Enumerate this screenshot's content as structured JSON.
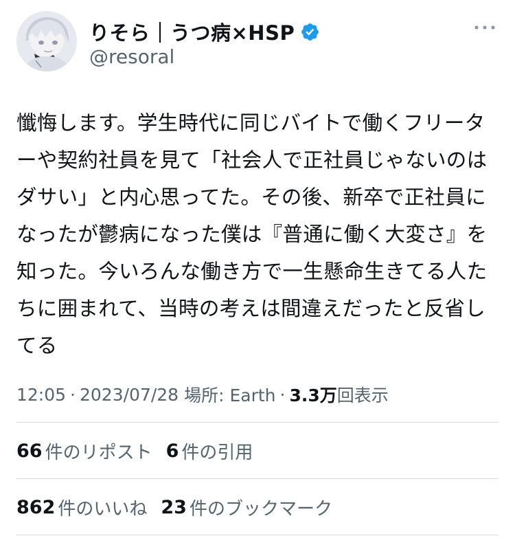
{
  "profile": {
    "display_name": "りそら｜うつ病×HSP",
    "handle": "@resoral",
    "verified_icon": "verified-badge-icon",
    "more_icon": "more-options-icon"
  },
  "tweet": {
    "text": "懺悔します。学生時代に同じバイトで働くフリーターや契約社員を見て「社会人で正社員じゃないのはダサい」と内心思ってた。その後、新卒で正社員になったが鬱病になった僕は『普通に働く大変さ』を知った。今いろんな働き方で一生懸命生きてる人たちに囲まれて、当時の考えは間違えだったと反省してる"
  },
  "meta": {
    "time": "12:05",
    "separator": "·",
    "date": "2023/07/28",
    "location": "場所: Earth",
    "views_count": "3.3万",
    "views_label": "回表示"
  },
  "stats": {
    "reposts_count": "66",
    "reposts_label": "件のリポスト",
    "quotes_count": "6",
    "quotes_label": "件の引用",
    "likes_count": "862",
    "likes_label": "件のいいね",
    "bookmarks_count": "23",
    "bookmarks_label": "件のブックマーク"
  },
  "colors": {
    "text": "#0f1419",
    "secondary": "#536471",
    "verified": "#1d9bf0",
    "divider": "#d6dbe0"
  }
}
